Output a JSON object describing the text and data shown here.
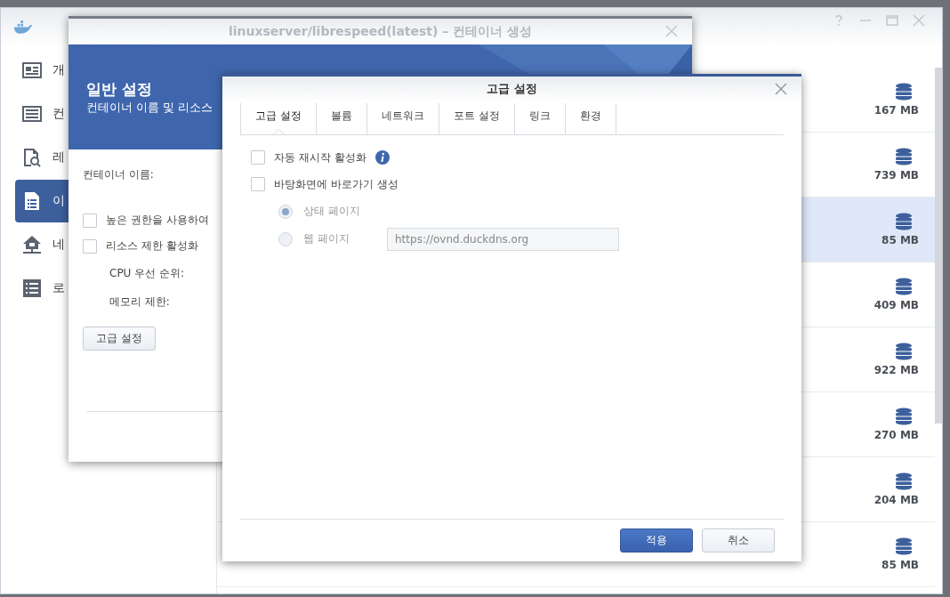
{
  "sidebar": {
    "items": [
      {
        "label": "개",
        "selected": false
      },
      {
        "label": "컨",
        "selected": false
      },
      {
        "label": "레",
        "selected": false
      },
      {
        "label": "이",
        "selected": true
      },
      {
        "label": "네",
        "selected": false
      },
      {
        "label": "로",
        "selected": false
      }
    ]
  },
  "image_list": {
    "rows": [
      {
        "size": "167 MB",
        "selected": false
      },
      {
        "size": "739 MB",
        "selected": false
      },
      {
        "size": "85 MB",
        "selected": true
      },
      {
        "size": "409 MB",
        "selected": false
      },
      {
        "size": "922 MB",
        "selected": false
      },
      {
        "size": "270 MB",
        "selected": false
      },
      {
        "size": "204 MB",
        "selected": false
      },
      {
        "size": "85 MB",
        "selected": false
      }
    ]
  },
  "create_dialog": {
    "title": "linuxserver/librespeed(latest) – 컨테이너 생성",
    "header_title": "일반 설정",
    "header_subtitle": "컨테이너 이름 및 리소스",
    "name_label": "컨테이너 이름:",
    "options": [
      {
        "label": "높은 권한을 사용하여",
        "checked": false
      },
      {
        "label": "리소스 제한 활성화",
        "checked": false
      }
    ],
    "resource_fields": [
      "CPU 우선 순위:",
      "메모리 제한:"
    ],
    "advanced_button": "고급 설정"
  },
  "advanced_dialog": {
    "title": "고급 설정",
    "tabs": [
      {
        "label": "고급 설정",
        "selected": true
      },
      {
        "label": "볼륨",
        "selected": false
      },
      {
        "label": "네트워크",
        "selected": false
      },
      {
        "label": "포트 설정",
        "selected": false
      },
      {
        "label": "링크",
        "selected": false
      },
      {
        "label": "환경",
        "selected": false
      }
    ],
    "options": [
      {
        "label": "자동 재시작 활성화",
        "checked": false,
        "info": true
      },
      {
        "label": "바탕화면에 바로가기 생성",
        "checked": false,
        "info": false
      }
    ],
    "shortcut_targets": [
      {
        "label": "상태 페이지",
        "selected": true,
        "disabled": true
      },
      {
        "label": "웹 페이지",
        "selected": false,
        "disabled": true
      }
    ],
    "url_field": {
      "value": "https://ovnd.duckdns.org",
      "disabled": true
    },
    "buttons": [
      {
        "label": "적용",
        "kind": "primary"
      },
      {
        "label": "취소",
        "kind": "secondary"
      }
    ]
  }
}
